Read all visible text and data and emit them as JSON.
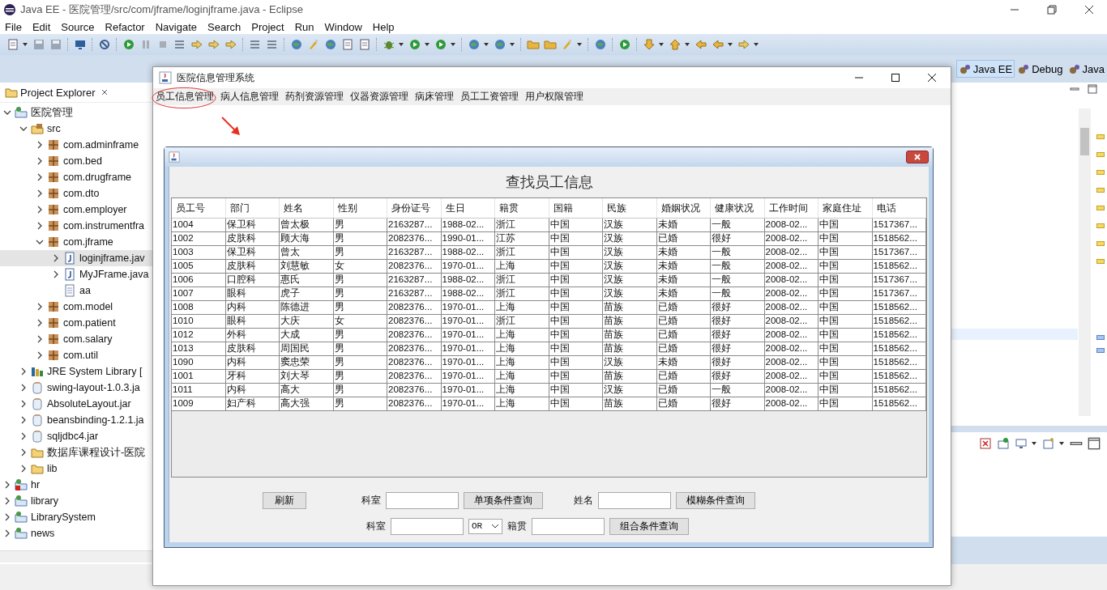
{
  "eclipse": {
    "title": "Java EE - 医院管理/src/com/jframe/loginjframe.java - Eclipse",
    "menu": [
      "File",
      "Edit",
      "Source",
      "Refactor",
      "Navigate",
      "Search",
      "Project",
      "Run",
      "Window",
      "Help"
    ],
    "perspectives": [
      {
        "label": "Java EE",
        "selected": true
      },
      {
        "label": "Debug",
        "selected": false
      },
      {
        "label": "Java",
        "selected": false
      }
    ],
    "explorer": {
      "title": "Project Explorer",
      "tree": [
        {
          "label": "医院管理",
          "kind": "project",
          "error": false,
          "expanded": true,
          "selected": false,
          "children": [
            {
              "label": "src",
              "kind": "src",
              "expanded": true,
              "selected": false,
              "children": [
                {
                  "label": "com.adminframe",
                  "kind": "package",
                  "expanded": false,
                  "selected": false
                },
                {
                  "label": "com.bed",
                  "kind": "package",
                  "expanded": false,
                  "selected": false
                },
                {
                  "label": "com.drugframe",
                  "kind": "package",
                  "expanded": false,
                  "selected": false
                },
                {
                  "label": "com.dto",
                  "kind": "package",
                  "expanded": false,
                  "selected": false
                },
                {
                  "label": "com.employer",
                  "kind": "package",
                  "expanded": false,
                  "selected": false
                },
                {
                  "label": "com.instrumentfra",
                  "kind": "package",
                  "expanded": false,
                  "selected": false
                },
                {
                  "label": "com.jframe",
                  "kind": "package",
                  "expanded": true,
                  "selected": false,
                  "children": [
                    {
                      "label": "loginjframe.jav",
                      "kind": "java",
                      "expanded": false,
                      "selected": true
                    },
                    {
                      "label": "MyJFrame.java",
                      "kind": "java",
                      "expanded": false,
                      "selected": false
                    },
                    {
                      "label": "aa",
                      "kind": "file",
                      "selected": false
                    }
                  ]
                },
                {
                  "label": "com.model",
                  "kind": "package",
                  "expanded": false,
                  "selected": false
                },
                {
                  "label": "com.patient",
                  "kind": "package",
                  "expanded": false,
                  "selected": false
                },
                {
                  "label": "com.salary",
                  "kind": "package",
                  "expanded": false,
                  "selected": false
                },
                {
                  "label": "com.util",
                  "kind": "package",
                  "expanded": false,
                  "selected": false
                }
              ]
            },
            {
              "label": "JRE System Library [",
              "kind": "library",
              "expanded": false,
              "selected": false
            },
            {
              "label": "swing-layout-1.0.3.ja",
              "kind": "jar",
              "expanded": false,
              "selected": false
            },
            {
              "label": "AbsoluteLayout.jar",
              "kind": "jar",
              "expanded": false,
              "selected": false
            },
            {
              "label": "beansbinding-1.2.1.ja",
              "kind": "jar",
              "expanded": false,
              "selected": false
            },
            {
              "label": "sqljdbc4.jar",
              "kind": "jar",
              "expanded": false,
              "selected": false
            },
            {
              "label": "数据库课程设计-医院",
              "kind": "folder",
              "expanded": false,
              "selected": false
            },
            {
              "label": "lib",
              "kind": "folder",
              "expanded": false,
              "selected": false
            }
          ]
        },
        {
          "label": "hr",
          "kind": "project",
          "error": true,
          "expanded": false,
          "selected": false
        },
        {
          "label": "library",
          "kind": "project",
          "error": false,
          "expanded": false,
          "selected": false
        },
        {
          "label": "LibrarySystem",
          "kind": "project",
          "error": false,
          "expanded": false,
          "selected": false
        },
        {
          "label": "news",
          "kind": "project",
          "error": false,
          "expanded": false,
          "selected": false
        }
      ]
    }
  },
  "app_window": {
    "title": "医院信息管理系统",
    "menu": [
      {
        "label": "员工信息管理",
        "circled": true
      },
      {
        "label": "病人信息管理",
        "circled": false
      },
      {
        "label": "药剂资源管理",
        "circled": false
      },
      {
        "label": "仪器资源管理",
        "circled": false
      },
      {
        "label": "病床管理",
        "circled": false
      },
      {
        "label": "员工工资管理",
        "circled": false
      },
      {
        "label": "用户权限管理",
        "circled": false
      }
    ]
  },
  "search_frame": {
    "heading": "查找员工信息",
    "table": {
      "columns": [
        "员工号",
        "部门",
        "姓名",
        "性别",
        "身份证号",
        "生日",
        "籍贯",
        "国籍",
        "民族",
        "婚姻状况",
        "健康状况",
        "工作时间",
        "家庭住址",
        "电话"
      ],
      "rows": [
        [
          "1004",
          "保卫科",
          "曾太极",
          "男",
          "2163287...",
          "1988-02...",
          "浙江",
          "中国",
          "汉族",
          "未婚",
          "一般",
          "2008-02...",
          "中国",
          "1517367..."
        ],
        [
          "1002",
          "皮肤科",
          "顾大海",
          "男",
          "2082376...",
          "1990-01...",
          "江苏",
          "中国",
          "汉族",
          "已婚",
          "很好",
          "2008-02...",
          "中国",
          "1518562..."
        ],
        [
          "1003",
          "保卫科",
          "曾太",
          "男",
          "2163287...",
          "1988-02...",
          "浙江",
          "中国",
          "汉族",
          "未婚",
          "一般",
          "2008-02...",
          "中国",
          "1517367..."
        ],
        [
          "1005",
          "皮肤科",
          "刘慧敏",
          "女",
          "2082376...",
          "1970-01...",
          "上海",
          "中国",
          "汉族",
          "未婚",
          "一般",
          "2008-02...",
          "中国",
          "1518562..."
        ],
        [
          "1006",
          "口腔科",
          "惠氏",
          "男",
          "2163287...",
          "1988-02...",
          "浙江",
          "中国",
          "汉族",
          "未婚",
          "一般",
          "2008-02...",
          "中国",
          "1517367..."
        ],
        [
          "1007",
          "眼科",
          "虎子",
          "男",
          "2163287...",
          "1988-02...",
          "浙江",
          "中国",
          "汉族",
          "未婚",
          "一般",
          "2008-02...",
          "中国",
          "1517367..."
        ],
        [
          "1008",
          "内科",
          "陈德进",
          "男",
          "2082376...",
          "1970-01...",
          "上海",
          "中国",
          "苗族",
          "已婚",
          "很好",
          "2008-02...",
          "中国",
          "1518562..."
        ],
        [
          "1010",
          "眼科",
          "大庆",
          "女",
          "2082376...",
          "1970-01...",
          "浙江",
          "中国",
          "苗族",
          "已婚",
          "很好",
          "2008-02...",
          "中国",
          "1518562..."
        ],
        [
          "1012",
          "外科",
          "大成",
          "男",
          "2082376...",
          "1970-01...",
          "上海",
          "中国",
          "苗族",
          "已婚",
          "很好",
          "2008-02...",
          "中国",
          "1518562..."
        ],
        [
          "1013",
          "皮肤科",
          "周国民",
          "男",
          "2082376...",
          "1970-01...",
          "上海",
          "中国",
          "苗族",
          "已婚",
          "很好",
          "2008-02...",
          "中国",
          "1518562..."
        ],
        [
          "1090",
          "内科",
          "窦忠荣",
          "男",
          "2082376...",
          "1970-01...",
          "上海",
          "中国",
          "汉族",
          "未婚",
          "很好",
          "2008-02...",
          "中国",
          "1518562..."
        ],
        [
          "1001",
          "牙科",
          "刘大琴",
          "男",
          "2082376...",
          "1970-01...",
          "上海",
          "中国",
          "苗族",
          "已婚",
          "很好",
          "2008-02...",
          "中国",
          "1518562..."
        ],
        [
          "1011",
          "内科",
          "高大",
          "男",
          "2082376...",
          "1970-01...",
          "上海",
          "中国",
          "汉族",
          "已婚",
          "一般",
          "2008-02...",
          "中国",
          "1518562..."
        ],
        [
          "1009",
          "妇产科",
          "高大强",
          "男",
          "2082376...",
          "1970-01...",
          "上海",
          "中国",
          "苗族",
          "已婚",
          "很好",
          "2008-02...",
          "中国",
          "1518562..."
        ]
      ]
    },
    "controls": [
      [
        {
          "kind": "button",
          "label": "刷新"
        },
        {
          "kind": "label",
          "text": "科室"
        },
        {
          "kind": "input"
        },
        {
          "kind": "button",
          "label": "单项条件查询"
        },
        {
          "kind": "label",
          "text": "姓名"
        },
        {
          "kind": "input"
        },
        {
          "kind": "button",
          "label": "模糊条件查询"
        }
      ],
      [
        {
          "kind": "label",
          "text": "科室"
        },
        {
          "kind": "input"
        },
        {
          "kind": "select",
          "value": "OR"
        },
        {
          "kind": "label",
          "text": "籍贯"
        },
        {
          "kind": "input"
        },
        {
          "kind": "button",
          "label": "组合条件查询"
        }
      ]
    ]
  }
}
